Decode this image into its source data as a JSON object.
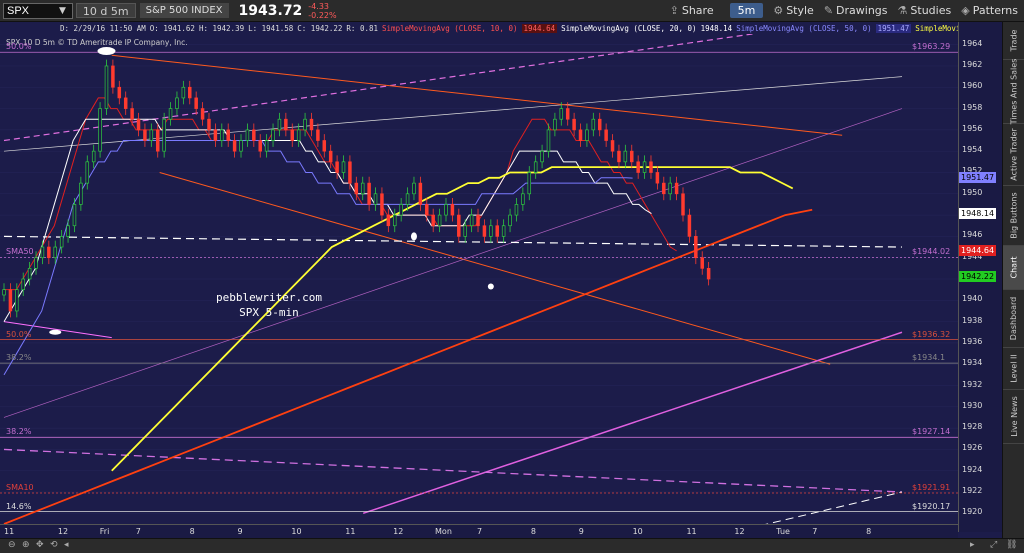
{
  "toolbar": {
    "symbol": "SPX",
    "period": "10 d 5m",
    "security_name": "S&P 500 INDEX",
    "last_price": "1943.72",
    "change": "-4.33",
    "change_pct": "-0.22%",
    "share_label": "Share",
    "timeframe": "5m",
    "style_label": "Style",
    "drawings_label": "Drawings",
    "studies_label": "Studies",
    "patterns_label": "Patterns"
  },
  "infobar": {
    "stamp": "D: 2/29/16 11:50 AM",
    "open": "O: 1941.62",
    "high": "H: 1942.39",
    "low": "L: 1941.58",
    "close": "C: 1942.22",
    "range": "R: 0.81",
    "sma10_name": "SimpleMovingAvg (CLOSE, 10, 0)",
    "sma10_val": "1944.64",
    "sma20_name": "SimpleMovingAvg (CLOSE, 20, 0)",
    "sma20_val": "1948.14",
    "sma50_name": "SimpleMovingAvg (CLOSE, 50, 0)",
    "sma50_val": "1951.47",
    "sma200_name": "SimpleMovingAvg",
    "source": "SPX 10 D 5m © TD Ameritrade IP Company, Inc."
  },
  "levels": [
    {
      "label_right": "$1963.29",
      "label_left": "50.0%",
      "value": 1963.29,
      "color": "#c36fd0"
    },
    {
      "label_right": "$1944.02",
      "label_left": "SMA50",
      "value": 1944.02,
      "color": "#c36fd0"
    },
    {
      "label_right": "$1936.32",
      "label_left": "50.0%",
      "value": 1936.32,
      "color": "#d8503c"
    },
    {
      "label_right": "$1934.1",
      "label_left": "38.2%",
      "value": 1934.1,
      "color": "#888888"
    },
    {
      "label_right": "$1927.14",
      "label_left": "38.2%",
      "value": 1927.14,
      "color": "#c36fd0"
    },
    {
      "label_right": "$1921.91",
      "label_left": "SMA10",
      "value": 1921.91,
      "color": "#e0403a"
    },
    {
      "label_right": "$1920.17",
      "label_left": "14.6%",
      "value": 1920.17,
      "color": "#dddddd"
    }
  ],
  "badges": [
    {
      "text": "1951.47",
      "value": 1951.47,
      "bg": "#8080ff",
      "fg": "#000000"
    },
    {
      "text": "1948.14",
      "value": 1948.14,
      "bg": "#ffffff",
      "fg": "#000000"
    },
    {
      "text": "1944.64",
      "value": 1944.64,
      "bg": "#e02020",
      "fg": "#ffffff"
    },
    {
      "text": "1942.22",
      "value": 1942.22,
      "bg": "#22cc22",
      "fg": "#000000"
    }
  ],
  "watermark": {
    "line1": "pebblewriter.com",
    "line2": "SPX 5-min"
  },
  "sidebar": [
    "Trade",
    "Times And Sales",
    "Active Trader",
    "Big Buttons",
    "Chart",
    "Dashboard",
    "Level II",
    "Live News"
  ],
  "sidebar_active": "Chart",
  "chart_data": {
    "type": "candlestick",
    "title": "SPX 10 D 5m",
    "ylim": [
      1919,
      1965
    ],
    "yticks": [
      1920,
      1922,
      1924,
      1926,
      1928,
      1930,
      1932,
      1934,
      1936,
      1938,
      1940,
      1942,
      1944,
      1946,
      1948,
      1950,
      1952,
      1954,
      1956,
      1958,
      1960,
      1962,
      1964
    ],
    "x_ticks": [
      "11",
      "12",
      "Fri",
      "7",
      "8",
      "9",
      "10",
      "11",
      "12",
      "Mon",
      "7",
      "8",
      "9",
      "10",
      "11",
      "12",
      "Tue",
      "7",
      "8"
    ],
    "x_tick_pos": [
      0,
      9,
      16,
      22,
      31,
      39,
      48,
      57,
      65,
      72,
      79,
      88,
      96,
      105,
      114,
      122,
      129,
      135,
      144
    ],
    "candles_close": [
      1941,
      1939,
      1941,
      1942,
      1943,
      1944,
      1945,
      1944,
      1945,
      1946,
      1947,
      1949,
      1951,
      1953,
      1954,
      1958,
      1962,
      1960,
      1959,
      1958,
      1957,
      1956,
      1955,
      1956,
      1954,
      1957,
      1958,
      1959,
      1960,
      1959,
      1958,
      1957,
      1956,
      1955,
      1956,
      1955,
      1954,
      1955,
      1956,
      1955,
      1954,
      1955,
      1956,
      1957,
      1956,
      1955,
      1956,
      1957,
      1956,
      1955,
      1954,
      1953,
      1952,
      1953,
      1951,
      1950,
      1951,
      1949,
      1950,
      1948,
      1947,
      1948,
      1949,
      1950,
      1951,
      1949,
      1948,
      1947,
      1948,
      1949,
      1948,
      1946,
      1947,
      1948,
      1947,
      1946,
      1947,
      1946,
      1947,
      1948,
      1949,
      1950,
      1952,
      1953,
      1954,
      1956,
      1957,
      1958,
      1957,
      1956,
      1955,
      1956,
      1957,
      1956,
      1955,
      1954,
      1953,
      1954,
      1953,
      1952,
      1953,
      1952,
      1951,
      1950,
      1951,
      1950,
      1948,
      1946,
      1944,
      1943,
      1942
    ],
    "series": [
      {
        "name": "SMA10",
        "color": "#e02020",
        "values": [
          1941,
          1941,
          1941,
          1942,
          1943,
          1944,
          1945,
          1946,
          1947,
          1949,
          1951,
          1953,
          1955,
          1957,
          1958,
          1959,
          1959,
          1958,
          1958,
          1957,
          1957,
          1956,
          1956,
          1956,
          1956,
          1956,
          1957,
          1957,
          1957,
          1957,
          1957,
          1956,
          1956,
          1955,
          1955,
          1955,
          1955,
          1955,
          1955,
          1955,
          1955,
          1955,
          1955,
          1956,
          1956,
          1956,
          1956,
          1956,
          1956,
          1955,
          1954,
          1953,
          1953,
          1952,
          1951,
          1951,
          1950,
          1949,
          1949,
          1949,
          1949,
          1948,
          1948,
          1948,
          1948,
          1948,
          1948,
          1948,
          1948,
          1947,
          1947,
          1947,
          1947,
          1947,
          1947,
          1947,
          1948,
          1949,
          1950,
          1951,
          1952,
          1954,
          1955,
          1956,
          1957,
          1957,
          1957,
          1956,
          1956,
          1956,
          1956,
          1955,
          1955,
          1955,
          1954,
          1953,
          1953,
          1952,
          1952,
          1951,
          1951,
          1950,
          1949,
          1948,
          1947,
          1946,
          1945,
          1944.64
        ]
      },
      {
        "name": "SMA20",
        "color": "#ffffff",
        "values": [
          1938,
          1939,
          1940,
          1941,
          1942,
          1943,
          1945,
          1947,
          1949,
          1951,
          1953,
          1955,
          1956,
          1957,
          1957,
          1957,
          1957,
          1957,
          1957,
          1957,
          1957,
          1957,
          1957,
          1957,
          1957,
          1956,
          1956,
          1956,
          1956,
          1956,
          1956,
          1956,
          1956,
          1956,
          1956,
          1956,
          1955,
          1955,
          1955,
          1955,
          1955,
          1955,
          1955,
          1955,
          1955,
          1955,
          1955,
          1955,
          1954,
          1954,
          1953,
          1953,
          1952,
          1952,
          1951,
          1951,
          1950,
          1950,
          1950,
          1949,
          1949,
          1949,
          1948,
          1948,
          1948,
          1948,
          1948,
          1948,
          1947,
          1947,
          1947,
          1947,
          1947,
          1947,
          1948,
          1948,
          1948,
          1949,
          1950,
          1951,
          1952,
          1953,
          1954,
          1954,
          1954,
          1954,
          1954,
          1954,
          1954,
          1953,
          1953,
          1953,
          1952,
          1952,
          1951,
          1951,
          1951,
          1950,
          1950,
          1950,
          1949,
          1949,
          1948.5,
          1948.14
        ]
      },
      {
        "name": "SMA50",
        "color": "#7a7aff",
        "values": [
          1933,
          1934,
          1935,
          1936,
          1937,
          1938,
          1939,
          1941,
          1943,
          1945,
          1947,
          1949,
          1950,
          1951,
          1952,
          1953,
          1953,
          1954,
          1954,
          1955,
          1955,
          1955,
          1955,
          1955,
          1955,
          1955,
          1955,
          1955,
          1955,
          1955,
          1955,
          1955,
          1955,
          1955,
          1955,
          1955,
          1955,
          1955,
          1955,
          1955,
          1955,
          1955,
          1954,
          1954,
          1954,
          1953,
          1953,
          1953,
          1952,
          1952,
          1951,
          1951,
          1951,
          1950,
          1950,
          1950,
          1949,
          1949,
          1949,
          1949,
          1949,
          1949,
          1949,
          1949,
          1949,
          1949,
          1949,
          1949,
          1949,
          1949,
          1949,
          1949,
          1949,
          1949,
          1949,
          1949,
          1950,
          1950,
          1950,
          1950,
          1950,
          1950,
          1950.5,
          1951,
          1951,
          1951,
          1951,
          1951,
          1951,
          1951,
          1951,
          1951,
          1951,
          1951,
          1951,
          1951.5,
          1951.5,
          1951.5,
          1951.5,
          1951.5,
          1951.47
        ]
      },
      {
        "name": "SMA200",
        "color": "#ffff33",
        "values": [
          1924,
          1925,
          1926,
          1927,
          1928,
          1929,
          1930,
          1931,
          1932,
          1933,
          1934,
          1935,
          1936,
          1937,
          1938,
          1939,
          1940,
          1941,
          1942,
          1943,
          1944,
          1945,
          1945.5,
          1946,
          1946.5,
          1947,
          1947.5,
          1948,
          1948.5,
          1949,
          1949.5,
          1950,
          1950,
          1950.5,
          1951,
          1951,
          1951.5,
          1951.5,
          1952,
          1952,
          1952,
          1952,
          1952.5,
          1952.5,
          1952.5,
          1952.5,
          1952.5,
          1952.5,
          1952.5,
          1952.5,
          1952.5,
          1952.5,
          1952.5,
          1952.5,
          1952.5,
          1952.5,
          1952.5,
          1952.5,
          1952.5,
          1952.5,
          1952,
          1952,
          1952,
          1951.5,
          1951,
          1950.5
        ]
      },
      {
        "name": "SMA200-daily",
        "color": "#ff4010",
        "values": [
          1919,
          1920,
          1921,
          1922,
          1923,
          1924,
          1925,
          1926,
          1927,
          1928,
          1929,
          1930,
          1931,
          1932,
          1933,
          1934,
          1935,
          1936,
          1937,
          1938,
          1939,
          1940,
          1941,
          1942,
          1943,
          1944,
          1945,
          1946,
          1947,
          1948,
          1948.5
        ]
      }
    ]
  }
}
